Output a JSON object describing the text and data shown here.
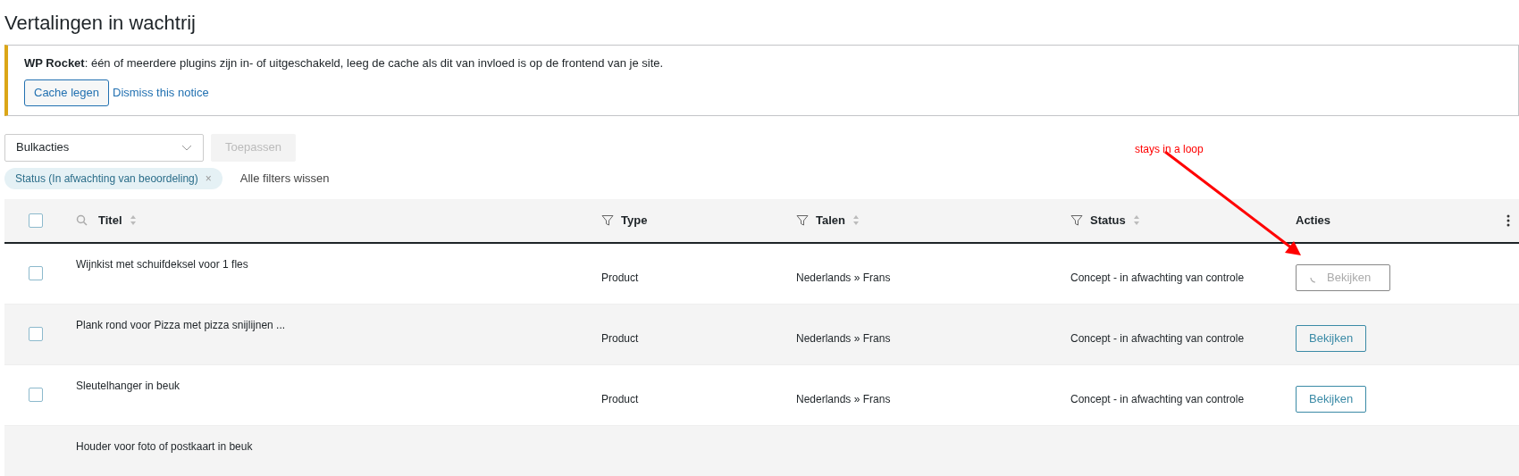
{
  "page_title": "Vertalingen in wachtrij",
  "notice": {
    "text": "**WP Rocket**: één of meerdere plugins zijn in- of uitgeschakeld, leeg de cache als dit van invloed is op de frontend van je site.",
    "button": "Cache legen",
    "link": "Dismiss this notice"
  },
  "bulk": {
    "select": "Bulkacties",
    "apply": "Toepassen",
    "apply_disabled": true
  },
  "filters": [
    {
      "label": "Status (In afwachting van beoordeling)",
      "remove": "×"
    }
  ],
  "clear_filters": "Alle filters wissen",
  "table": {
    "select_all_checked": false,
    "columns": [
      {
        "label": "Titel"
      },
      {
        "label": "Type"
      },
      {
        "label": "Talen"
      },
      {
        "label": "Status"
      },
      {
        "label": "Acties"
      }
    ],
    "rows": [
      {
        "checked": false,
        "title": "Wijnkist met schuifdeksel voor 1 fles",
        "type": "Product",
        "languages": "Nederlands » Frans",
        "status": "Concept - in afwachting van controle",
        "action": "Bekijken",
        "loading": true
      },
      {
        "checked": false,
        "title": "Plank rond voor Pizza met pizza snijlijnen ...",
        "type": "Product",
        "languages": "Nederlands » Frans",
        "status": "Concept - in afwachting van controle",
        "action": "Bekijken",
        "loading": false
      },
      {
        "checked": false,
        "title": "Sleutelhanger in beuk",
        "type": "Product",
        "languages": "Nederlands » Frans",
        "status": "Concept - in afwachting van controle",
        "action": "Bekijken",
        "loading": false
      },
      {
        "title": "Houder voor foto of postkaart in beuk"
      }
    ]
  },
  "annotation": {
    "text": "stays in a loop",
    "color": "#ff0000"
  }
}
